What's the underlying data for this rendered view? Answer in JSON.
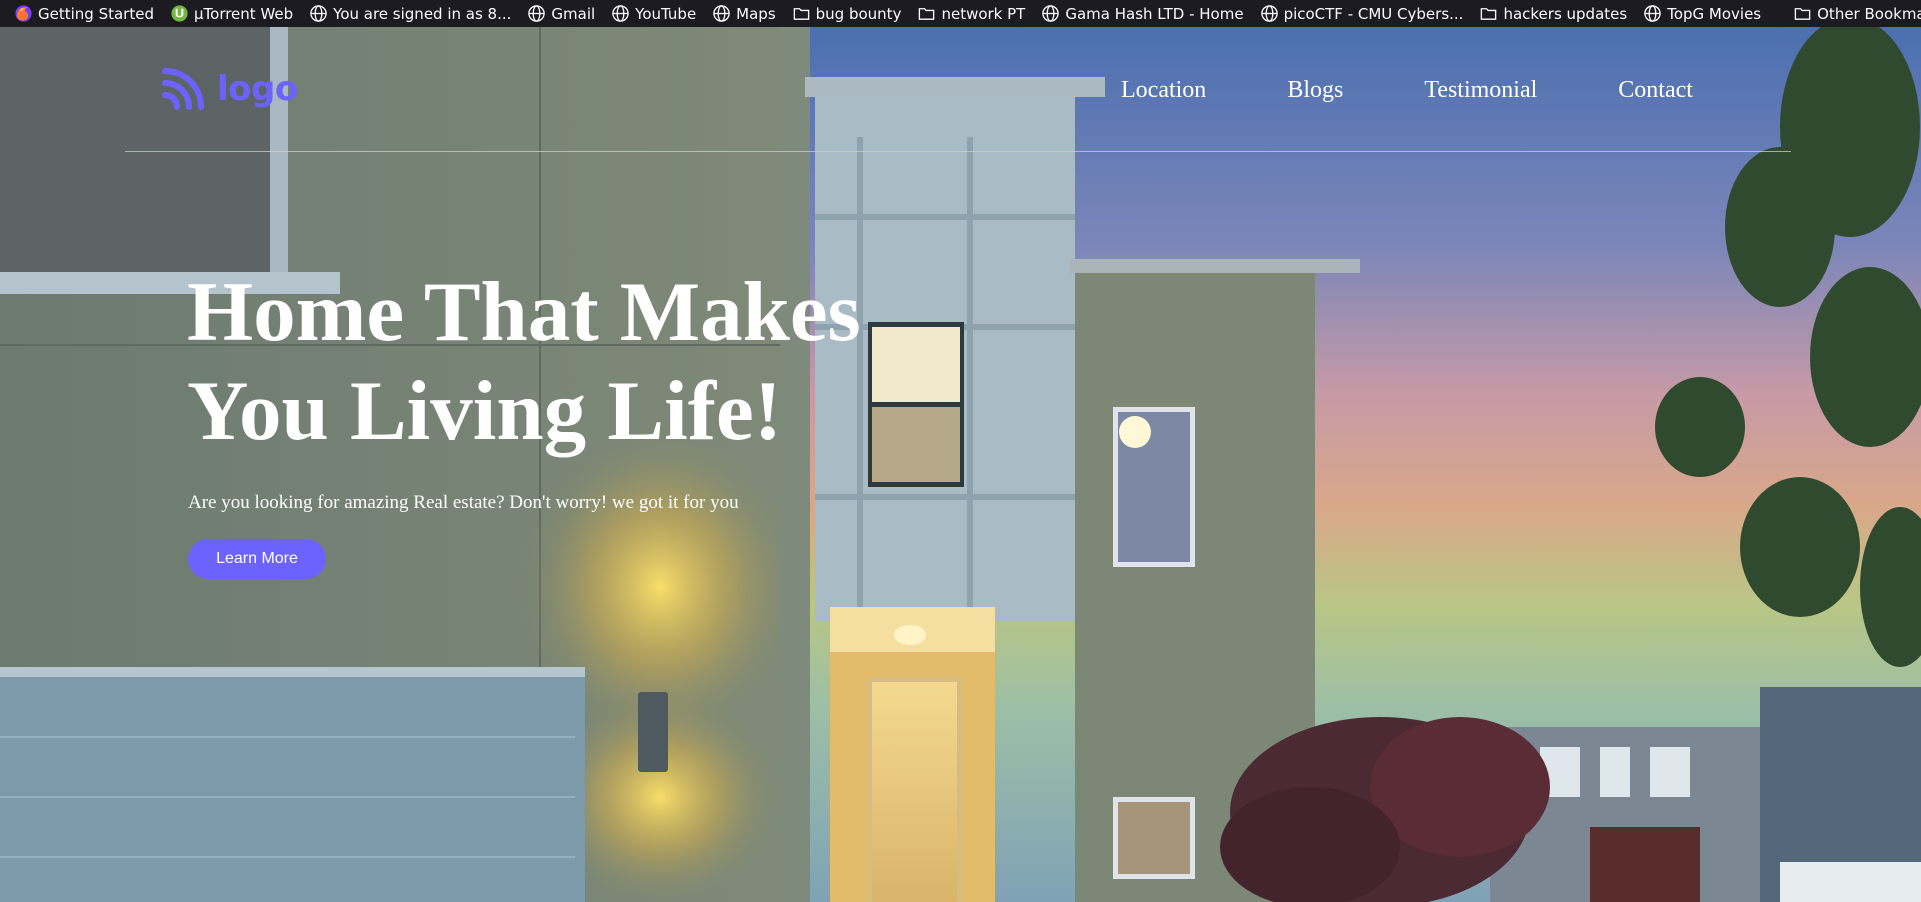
{
  "bookmarks": {
    "items": [
      {
        "label": "Getting Started",
        "icon": "firefox-icon"
      },
      {
        "label": "µTorrent Web",
        "icon": "utorrent-icon"
      },
      {
        "label": "You are signed in as 8...",
        "icon": "globe-icon"
      },
      {
        "label": "Gmail",
        "icon": "globe-icon"
      },
      {
        "label": "YouTube",
        "icon": "globe-icon"
      },
      {
        "label": "Maps",
        "icon": "globe-icon"
      },
      {
        "label": "bug bounty",
        "icon": "folder-icon"
      },
      {
        "label": "network PT",
        "icon": "folder-icon"
      },
      {
        "label": "Gama Hash LTD - Home",
        "icon": "globe-icon"
      },
      {
        "label": "picoCTF - CMU Cybers...",
        "icon": "globe-icon"
      },
      {
        "label": "hackers updates",
        "icon": "folder-icon"
      },
      {
        "label": "TopG Movies",
        "icon": "globe-icon"
      }
    ],
    "overflow_icon": "chevrons-right-icon",
    "other": {
      "label": "Other Bookmarks",
      "icon": "folder-icon"
    }
  },
  "site": {
    "logo_text": "logo",
    "logo_icon": "wifi-signal-icon",
    "nav": [
      {
        "label": "Location"
      },
      {
        "label": "Blogs"
      },
      {
        "label": "Testimonial"
      },
      {
        "label": "Contact"
      }
    ]
  },
  "hero": {
    "title_line1": "Home That Makes",
    "title_line2": "You Living Life!",
    "subtitle": "Are you looking for amazing Real estate? Don't worry! we got it for you",
    "cta_label": "Learn More"
  },
  "colors": {
    "accent": "#6c63ff",
    "bookmarks_bg": "#1c1b22",
    "text": "#ffffff"
  }
}
